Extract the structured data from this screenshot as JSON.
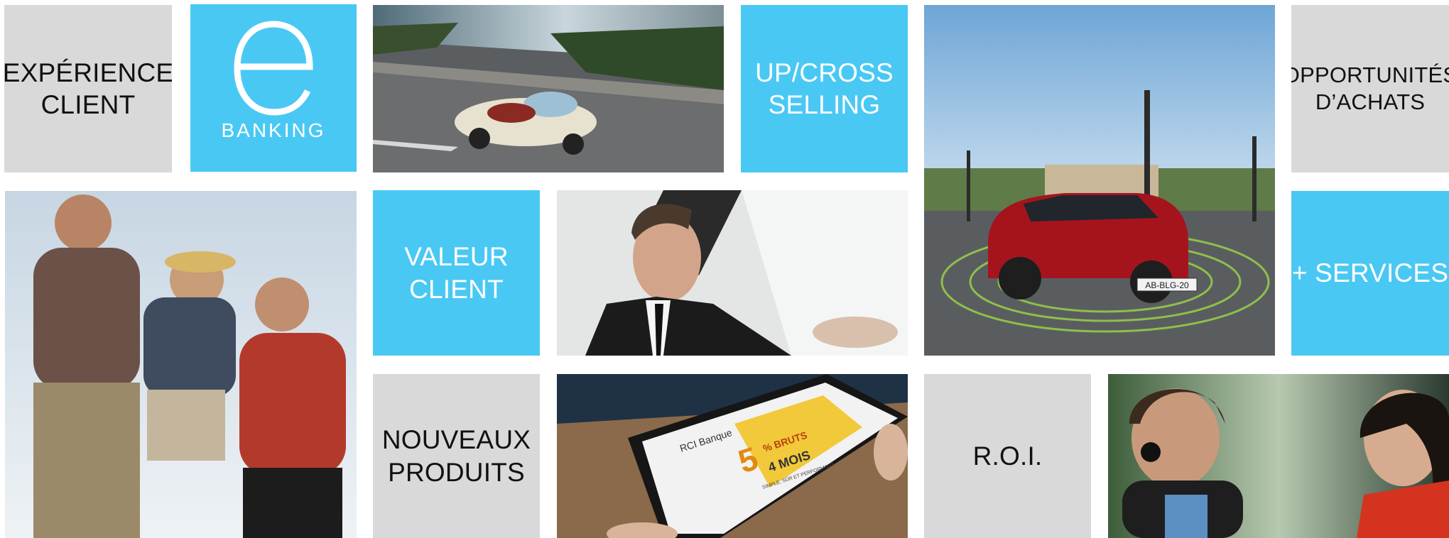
{
  "tiles": {
    "experience_client": "EXPÉRIENCE\nCLIENT",
    "ebanking": {
      "letter": "e",
      "word": "BANKING"
    },
    "up_cross_selling": "UP/CROSS\nSELLING",
    "opportunites_achats": "OPPORTUNITÉS\nD’ACHATS",
    "valeur_client": "VALEUR\nCLIENT",
    "plus_services": "+ SERVICES",
    "nouveaux_produits": "NOUVEAUX\nPRODUITS",
    "roi": "R.O.I."
  },
  "photos": {
    "convertible": "convertible-car-photo",
    "red_car": "red-car-photo",
    "family": "family-photo",
    "driver": "driver-photo",
    "tablet": "tablet-photo",
    "couple": "couple-photo"
  },
  "tablet_screen": {
    "brand": "RCI Banque",
    "promo_big": "5",
    "promo_unit": "% BRUTS",
    "promo_months": "4 MOIS",
    "promo_tag": "SIMPLE, SÛR ET PERFORMANT"
  },
  "plate": "AB-BLG-20",
  "colors": {
    "tile_blue": "#4ac8f4",
    "tile_gray": "#d9d9d9"
  }
}
